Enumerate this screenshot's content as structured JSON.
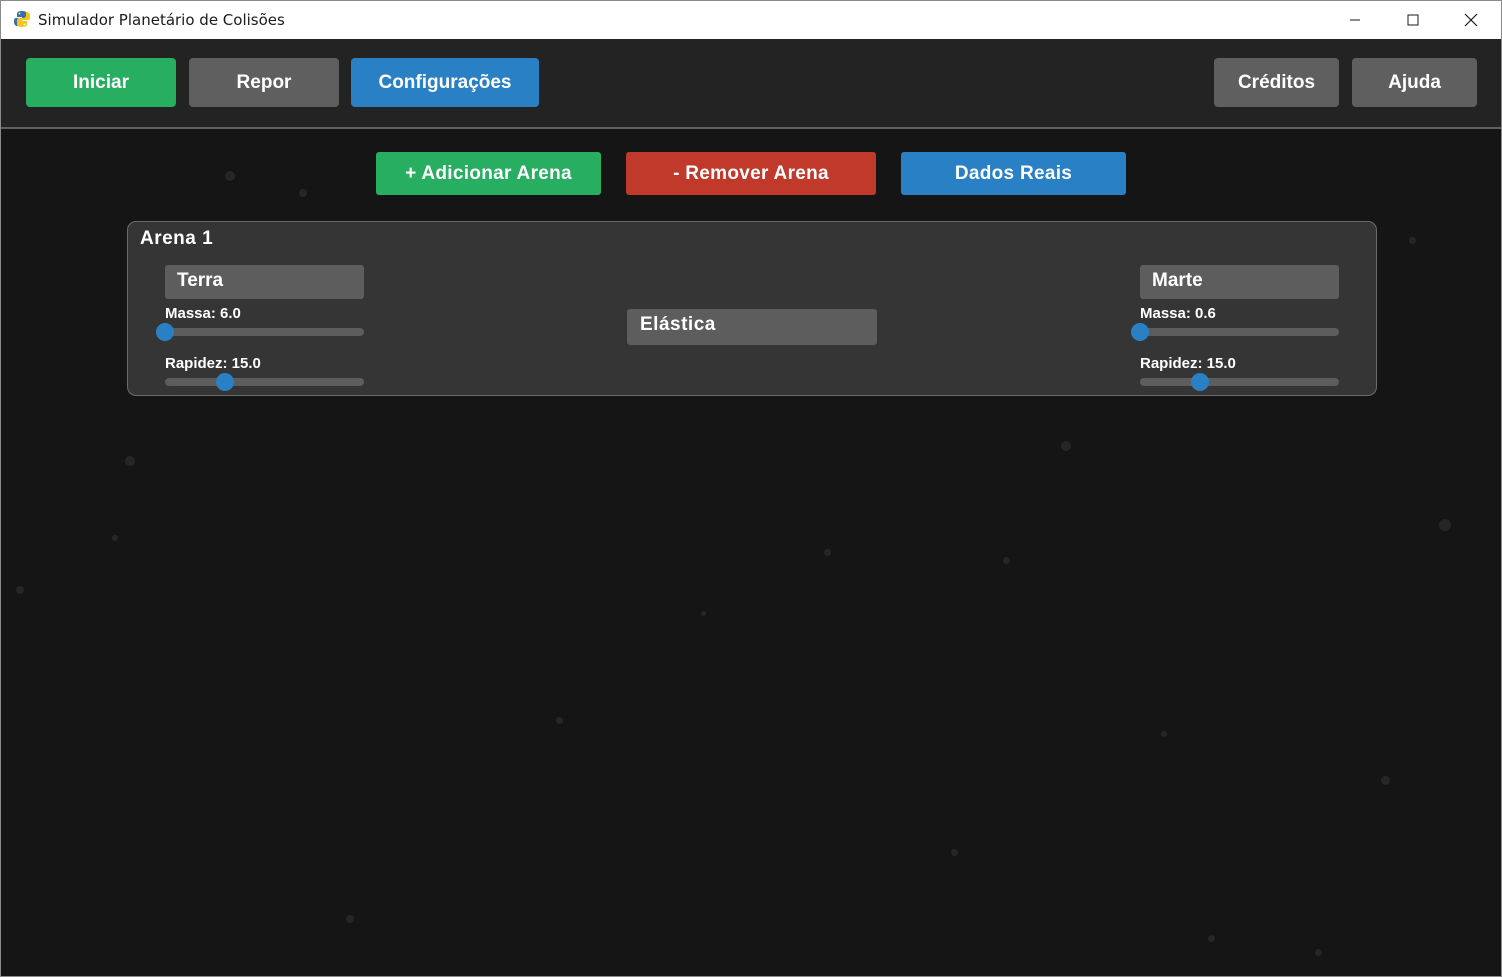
{
  "window": {
    "title": "Simulador Planetário de Colisões"
  },
  "toolbar": {
    "start_label": "Iniciar",
    "reset_label": "Repor",
    "settings_label": "Configurações",
    "credits_label": "Créditos",
    "help_label": "Ajuda"
  },
  "arena_actions": {
    "add_label": "+ Adicionar Arena",
    "remove_label": "- Remover Arena",
    "real_data_label": "Dados Reais"
  },
  "arenas": [
    {
      "title": "Arena 1",
      "collision_type": "Elástica",
      "left_planet": {
        "name": "Terra",
        "mass_label": "Massa: 6.0",
        "mass_value": 6.0,
        "mass_fraction": 0.0,
        "speed_label": "Rapidez: 15.0",
        "speed_value": 15.0,
        "speed_fraction": 0.3
      },
      "right_planet": {
        "name": "Marte",
        "mass_label": "Massa: 0.6",
        "mass_value": 0.6,
        "mass_fraction": 0.0,
        "speed_label": "Rapidez: 15.0",
        "speed_value": 15.0,
        "speed_fraction": 0.3
      }
    }
  ],
  "colors": {
    "green": "#27ae60",
    "gray_button": "#5f5f5f",
    "blue": "#2a80c4",
    "red": "#c0392b",
    "panel": "#353535",
    "background": "#151515",
    "slider_knob": "#2a80c4"
  },
  "icons": {
    "app": "python-snake-icon",
    "minimize": "minimize-icon",
    "maximize": "maximize-icon",
    "close": "close-icon"
  }
}
